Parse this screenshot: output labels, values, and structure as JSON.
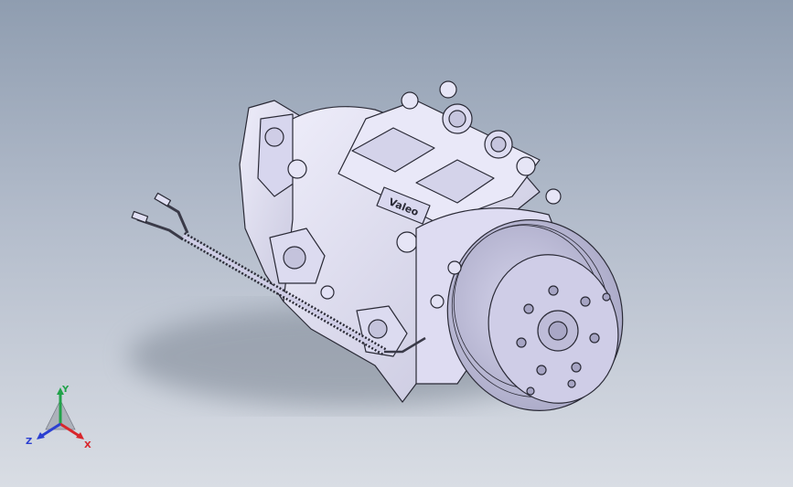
{
  "viewport": {
    "background_top": "#8f9db0",
    "background_bottom": "#d9dde4"
  },
  "model": {
    "brand_text": "Valeo",
    "body_color": "#e2e1f3",
    "edge_color": "#2a2a36",
    "shadow_color": "#7c8593"
  },
  "triad": {
    "x_label": "X",
    "y_label": "Y",
    "z_label": "Z",
    "x_color": "#d8262c",
    "y_color": "#21a24a",
    "z_color": "#2b3fd1"
  }
}
